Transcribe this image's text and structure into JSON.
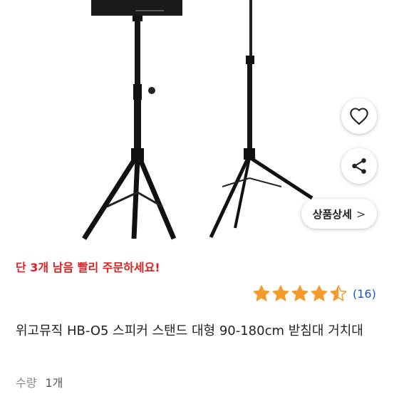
{
  "product": {
    "urgency_text": "단 3개 남음 빨리 주문하세요!",
    "rating": {
      "value": 4.5,
      "stars_total": 5,
      "review_count_label": "(16)",
      "star_color": "#f39c2c"
    },
    "title": "위고뮤직 HB-O5 스피커 스탠드 대형 90-180cm 받침대 거치대",
    "quantity": {
      "label": "수량",
      "value": "1개"
    }
  },
  "actions": {
    "detail_label": "상품상세",
    "detail_chevron": ">",
    "wishlist_icon": "heart-icon",
    "share_icon": "share-icon"
  },
  "colors": {
    "urgency": "#e02020",
    "review_link": "#1e56c8"
  }
}
